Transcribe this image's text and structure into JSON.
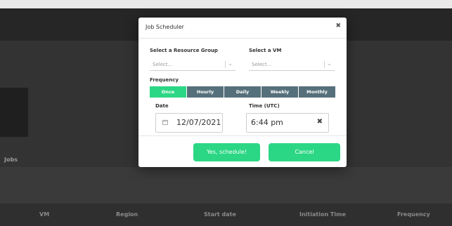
{
  "background": {
    "jobs_label": "Jobs",
    "table_headers": [
      "VM",
      "Region",
      "Start date",
      "Initiation Time",
      "Frequency"
    ]
  },
  "modal": {
    "title": "Job Scheduler",
    "close_icon": "close-icon",
    "resource_group": {
      "label": "Select a Resource Group",
      "placeholder": "Select..."
    },
    "vm": {
      "label": "Select a VM",
      "placeholder": "Select..."
    },
    "frequency": {
      "label": "Frequency",
      "options": [
        "Once",
        "Hourly",
        "Daily",
        "Weekly",
        "Monthly"
      ],
      "selected": "Once"
    },
    "date": {
      "label": "Date",
      "value": "12/07/2021",
      "icon": "calendar-icon"
    },
    "time": {
      "label": "Time (UTC)",
      "value": "6:44 pm",
      "clear_icon": "clear-icon"
    },
    "confirm_label": "Yes, schedule!",
    "cancel_label": "Cancel"
  },
  "colors": {
    "accent": "#2bd784",
    "segment_inactive": "#56707b",
    "overlay_bg": "#3a3a3a"
  }
}
